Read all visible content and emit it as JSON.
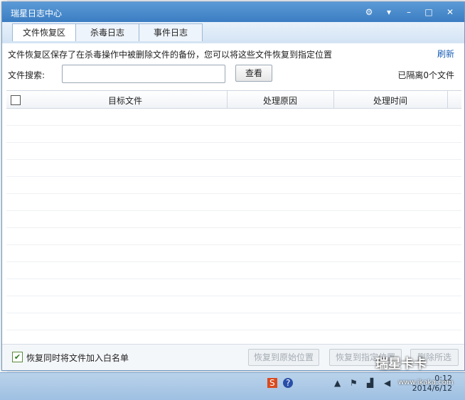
{
  "window": {
    "title": "瑞星日志中心",
    "controls": [
      "gear-icon",
      "dropdown-icon",
      "minimize-icon",
      "maximize-icon",
      "close-icon"
    ]
  },
  "tabs": [
    {
      "label": "文件恢复区",
      "active": true
    },
    {
      "label": "杀毒日志",
      "active": false
    },
    {
      "label": "事件日志",
      "active": false
    }
  ],
  "info_text": "文件恢复区保存了在杀毒操作中被删除文件的备份，您可以将这些文件恢复到指定位置",
  "refresh_label": "刷新",
  "search": {
    "label": "文件搜索:",
    "value": "",
    "button": "查看"
  },
  "isolated_count": "已隔离0个文件",
  "table": {
    "columns": [
      "目标文件",
      "处理原因",
      "处理时间"
    ],
    "rows": []
  },
  "footer": {
    "whitelist_checked": true,
    "whitelist_label": "恢复同时将文件加入白名单",
    "buttons": [
      "恢复到原始位置",
      "恢复到指定位置",
      "删除所选"
    ]
  },
  "taskbar": {
    "clock_time": "0:12",
    "clock_date": "2014/6/12"
  },
  "watermark": {
    "text": "瑞星卡卡",
    "url": "www.ikaka.com"
  },
  "colors": {
    "title_bar": "#3b7dc2",
    "accent_link": "#1a5fb4"
  }
}
